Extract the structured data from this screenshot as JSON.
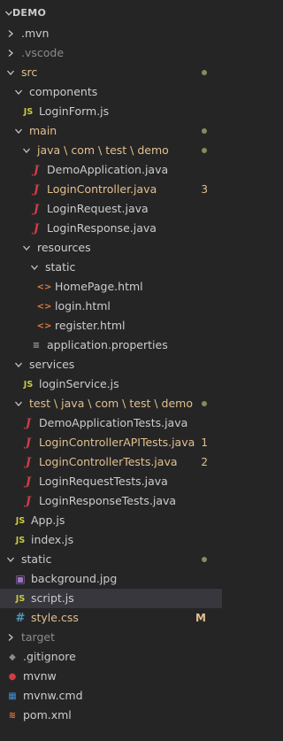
{
  "header": {
    "title": "DEMO"
  },
  "colors": {
    "background": "#252526",
    "selected_row": "#37373d",
    "modified": "#e2c08d",
    "error": "#f48771",
    "ignored": "#8b8b8b",
    "java_icon": "#cc3e44",
    "js_icon": "#cbcb41",
    "html_icon": "#e37933",
    "css_icon": "#519aba"
  },
  "tree": [
    {
      "label": ".mvn",
      "kind": "folder",
      "expanded": false,
      "depth": 0,
      "color": "default"
    },
    {
      "label": ".vscode",
      "kind": "folder",
      "expanded": false,
      "depth": 0,
      "color": "ignored"
    },
    {
      "label": "src",
      "kind": "folder",
      "expanded": true,
      "depth": 0,
      "color": "modified",
      "dot": true
    },
    {
      "label": "components",
      "kind": "folder",
      "expanded": true,
      "depth": 1,
      "color": "default"
    },
    {
      "label": "LoginForm.js",
      "kind": "file",
      "icon": "js-icon",
      "icon_text": "JS",
      "depth": 2,
      "color": "default"
    },
    {
      "label": "main",
      "kind": "folder",
      "expanded": true,
      "depth": 1,
      "color": "modified",
      "dot": true
    },
    {
      "label": "java \\ com \\ test \\ demo",
      "kind": "folder",
      "expanded": true,
      "depth": 2,
      "color": "modified",
      "dot": true
    },
    {
      "label": "DemoApplication.java",
      "kind": "file",
      "icon": "java-icon",
      "icon_text": "J",
      "depth": 3,
      "color": "default"
    },
    {
      "label": "LoginController.java",
      "kind": "file",
      "icon": "java-icon",
      "icon_text": "J",
      "depth": 3,
      "color": "modified",
      "badge": "3"
    },
    {
      "label": "LoginRequest.java",
      "kind": "file",
      "icon": "java-icon",
      "icon_text": "J",
      "depth": 3,
      "color": "default"
    },
    {
      "label": "LoginResponse.java",
      "kind": "file",
      "icon": "java-icon",
      "icon_text": "J",
      "depth": 3,
      "color": "default"
    },
    {
      "label": "resources",
      "kind": "folder",
      "expanded": true,
      "depth": 2,
      "color": "default"
    },
    {
      "label": "static",
      "kind": "folder",
      "expanded": true,
      "depth": 3,
      "color": "default"
    },
    {
      "label": "HomePage.html",
      "kind": "file",
      "icon": "html-icon",
      "icon_text": "<>",
      "depth": 4,
      "color": "default"
    },
    {
      "label": "login.html",
      "kind": "file",
      "icon": "html-icon",
      "icon_text": "<>",
      "depth": 4,
      "color": "default"
    },
    {
      "label": "register.html",
      "kind": "file",
      "icon": "html-icon",
      "icon_text": "<>",
      "depth": 4,
      "color": "default"
    },
    {
      "label": "application.properties",
      "kind": "file",
      "icon": "settings-file-icon",
      "icon_text": "≡",
      "depth": 3,
      "color": "default"
    },
    {
      "label": "services",
      "kind": "folder",
      "expanded": true,
      "depth": 1,
      "color": "default"
    },
    {
      "label": "loginService.js",
      "kind": "file",
      "icon": "js-icon",
      "icon_text": "JS",
      "depth": 2,
      "color": "default"
    },
    {
      "label": "test \\ java \\ com \\ test \\ demo",
      "kind": "folder",
      "expanded": true,
      "depth": 1,
      "color": "modified",
      "dot": true
    },
    {
      "label": "DemoApplicationTests.java",
      "kind": "file",
      "icon": "java-icon",
      "icon_text": "J",
      "depth": 2,
      "color": "default"
    },
    {
      "label": "LoginControllerAPITests.java",
      "kind": "file",
      "icon": "java-icon",
      "icon_text": "J",
      "depth": 2,
      "color": "modified",
      "badge": "1"
    },
    {
      "label": "LoginControllerTests.java",
      "kind": "file",
      "icon": "java-icon",
      "icon_text": "J",
      "depth": 2,
      "color": "modified",
      "badge": "2"
    },
    {
      "label": "LoginRequestTests.java",
      "kind": "file",
      "icon": "java-icon",
      "icon_text": "J",
      "depth": 2,
      "color": "default"
    },
    {
      "label": "LoginResponseTests.java",
      "kind": "file",
      "icon": "java-icon",
      "icon_text": "J",
      "depth": 2,
      "color": "default"
    },
    {
      "label": "App.js",
      "kind": "file",
      "icon": "js-icon",
      "icon_text": "JS",
      "depth": 1,
      "color": "default"
    },
    {
      "label": "index.js",
      "kind": "file",
      "icon": "js-icon",
      "icon_text": "JS",
      "depth": 1,
      "color": "default"
    },
    {
      "label": "static",
      "kind": "folder",
      "expanded": true,
      "depth": 0,
      "color": "default",
      "dot": true
    },
    {
      "label": "background.jpg",
      "kind": "file",
      "icon": "image-icon",
      "icon_text": "▣",
      "depth": 1,
      "color": "default"
    },
    {
      "label": "script.js",
      "kind": "file",
      "icon": "js-icon",
      "icon_text": "JS",
      "depth": 1,
      "color": "default",
      "selected": true
    },
    {
      "label": "style.css",
      "kind": "file",
      "icon": "css-icon",
      "icon_text": "#",
      "depth": 1,
      "color": "modified",
      "badge": "M"
    },
    {
      "label": "target",
      "kind": "folder",
      "expanded": false,
      "depth": 0,
      "color": "ignored"
    },
    {
      "label": ".gitignore",
      "kind": "file",
      "icon": "git-icon",
      "icon_text": "◆",
      "depth": 0,
      "color": "default"
    },
    {
      "label": "mvnw",
      "kind": "file",
      "icon": "maven-icon",
      "icon_text": "●",
      "depth": 0,
      "color": "default"
    },
    {
      "label": "mvnw.cmd",
      "kind": "file",
      "icon": "windows-icon",
      "icon_text": "▦",
      "depth": 0,
      "color": "default"
    },
    {
      "label": "pom.xml",
      "kind": "file",
      "icon": "xml-icon",
      "icon_text": "≋",
      "depth": 0,
      "color": "default"
    }
  ]
}
